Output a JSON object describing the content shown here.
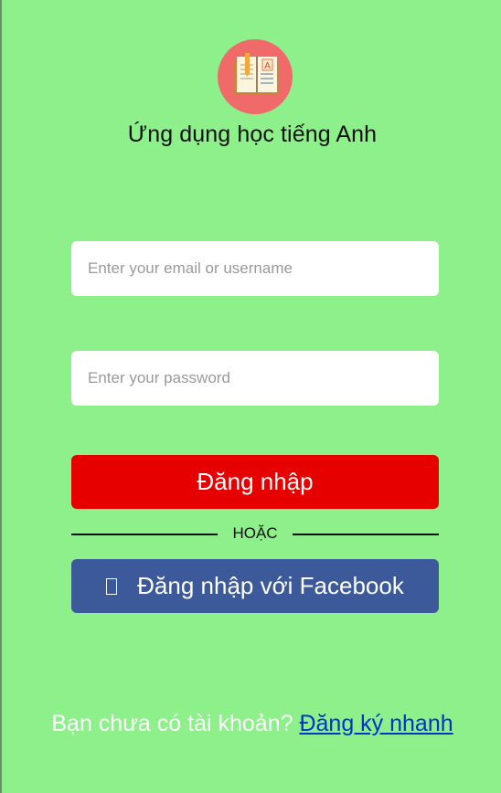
{
  "app": {
    "title": "Ứng dụng học tiếng Anh",
    "logo_icon": "book-icon"
  },
  "form": {
    "email_placeholder": "Enter your email or username",
    "email_value": "",
    "password_placeholder": "Enter your password",
    "password_value": "",
    "login_label": "Đăng nhập",
    "divider_label": "HOẶC",
    "facebook_label": "Đăng nhập với Facebook",
    "facebook_icon": "facebook-icon"
  },
  "footer": {
    "prompt": "Bạn chưa có tài khoản?",
    "signup_link": "Đăng ký nhanh"
  },
  "colors": {
    "background": "#8ef08b",
    "logo_circle": "#ef6a68",
    "login_button": "#e60000",
    "facebook_button": "#3c5a9a",
    "link": "#0033cc"
  }
}
